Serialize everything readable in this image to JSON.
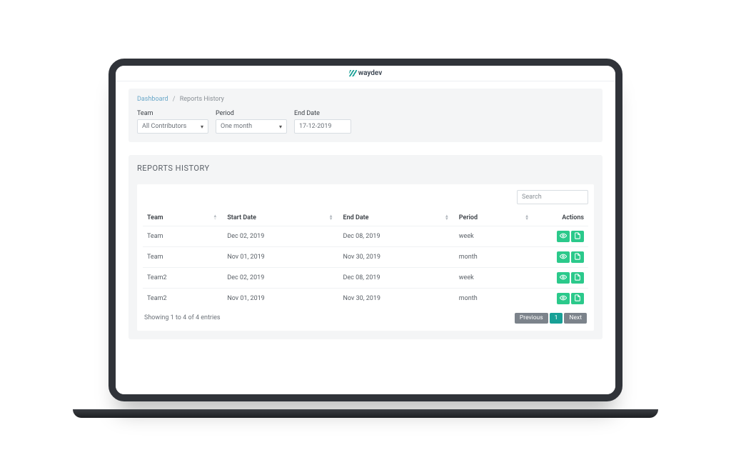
{
  "brand": "waydev",
  "breadcrumb": {
    "root": "Dashboard",
    "current": "Reports History"
  },
  "filters": {
    "team": {
      "label": "Team",
      "value": "All Contributors"
    },
    "period": {
      "label": "Period",
      "value": "One month"
    },
    "end_date": {
      "label": "End Date",
      "value": "17-12-2019"
    }
  },
  "section_title": "REPORTS HISTORY",
  "search_placeholder": "Search",
  "columns": {
    "team": "Team",
    "start": "Start Date",
    "end": "End Date",
    "period": "Period",
    "actions": "Actions"
  },
  "rows": [
    {
      "team": "Team",
      "start": "Dec 02, 2019",
      "end": "Dec 08, 2019",
      "period": "week"
    },
    {
      "team": "Team",
      "start": "Nov 01, 2019",
      "end": "Nov 30, 2019",
      "period": "month"
    },
    {
      "team": "Team2",
      "start": "Dec 02, 2019",
      "end": "Dec 08, 2019",
      "period": "week"
    },
    {
      "team": "Team2",
      "start": "Nov 01, 2019",
      "end": "Nov 30, 2019",
      "period": "month"
    }
  ],
  "entries_text": "Showing 1 to 4 of 4 entries",
  "pager": {
    "prev": "Previous",
    "page": "1",
    "next": "Next"
  }
}
